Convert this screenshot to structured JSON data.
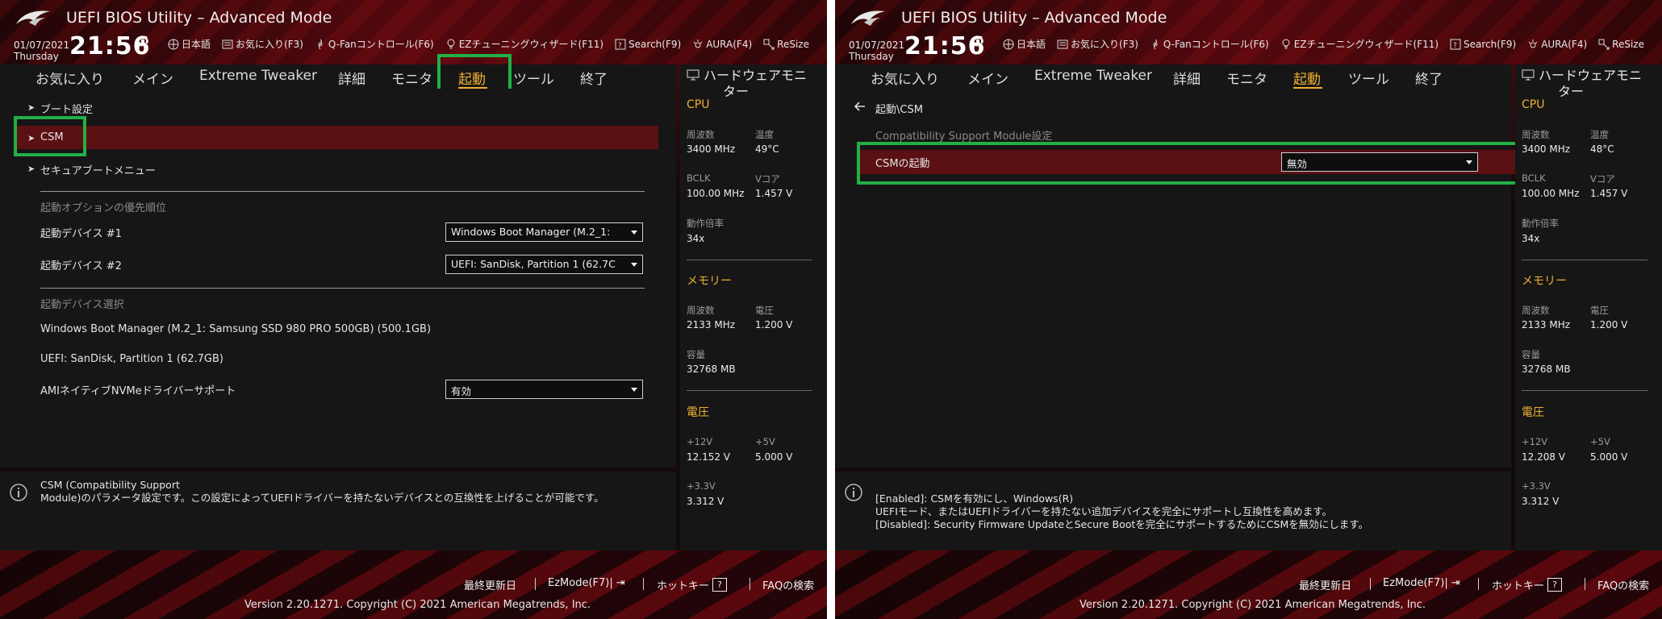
{
  "left": {
    "header": {
      "title": "UEFI BIOS Utility – Advanced Mode",
      "date": "01/07/2021",
      "weekday": "Thursday",
      "time": "21:56",
      "toolbar": [
        "日本語",
        "お気に入り(F3)",
        "Q-Fanコントロール(F6)",
        "EZチューニングウィザード(F11)",
        "Search(F9)",
        "AURA(F4)",
        "ReSize"
      ]
    },
    "tabs": [
      "お気に入り",
      "メイン",
      "Extreme Tweaker",
      "詳細",
      "モニタ",
      "起動",
      "ツール",
      "終了"
    ],
    "active_tab": "起動",
    "menu": {
      "boot_config": "ブート設定",
      "csm": "CSM",
      "secure_boot": "セキュアブートメニュー",
      "priority_header": "起動オプションの優先順位",
      "dev1_label": "起動デバイス #1",
      "dev1_value": "Windows Boot Manager (M.2_1:",
      "dev2_label": "起動デバイス #2",
      "dev2_value": "UEFI: SanDisk, Partition 1 (62.7C",
      "select_header": "起動デバイス選択",
      "device_a": "Windows Boot Manager (M.2_1: Samsung SSD 980 PRO 500GB) (500.1GB)",
      "device_b": "UEFI: SanDisk, Partition 1 (62.7GB)",
      "nvme_label": "AMIネイティブNVMeドライバーサポート",
      "nvme_value": "有効"
    },
    "help": {
      "line1": "CSM (Compatibility Support",
      "line2": "Module)のパラメータ設定です。この設定によってUEFIドライバーを持たないデバイスとの互換性を上げることが可能です。"
    },
    "hw": {
      "title_line1": "ハードウェアモニ",
      "title_line2": "ター",
      "cpu": "CPU",
      "freq_label": "周波数",
      "freq_value": "3400 MHz",
      "temp_label": "温度",
      "temp_value": "49°C",
      "bclk_label": "BCLK",
      "bclk_value": "100.00 MHz",
      "vcore_label": "Vコア",
      "vcore_value": "1.457 V",
      "ratio_label": "動作倍率",
      "ratio_value": "34x",
      "memory": "メモリー",
      "mfreq_label": "周波数",
      "mfreq_value": "2133 MHz",
      "volt_label": "電圧",
      "volt_value": "1.200 V",
      "cap_label": "容量",
      "cap_value": "32768 MB",
      "voltage": "電圧",
      "v12_label": "+12V",
      "v12_value": "12.152 V",
      "v5_label": "+5V",
      "v5_value": "5.000 V",
      "v33_label": "+3.3V",
      "v33_value": "3.312 V"
    },
    "footer": {
      "last_modified": "最終更新日",
      "ezmode": "EzMode(F7)|",
      "hotkeys": "ホットキー",
      "hotkey_glyph": "?",
      "faq": "FAQの検索",
      "copyright": "Version 2.20.1271. Copyright (C) 2021 American Megatrends, Inc."
    }
  },
  "right": {
    "header": {
      "title": "UEFI BIOS Utility – Advanced Mode",
      "date": "01/07/2021",
      "weekday": "Thursday",
      "time": "21:56",
      "toolbar": [
        "日本語",
        "お気に入り(F3)",
        "Q-Fanコントロール(F6)",
        "EZチューニングウィザード(F11)",
        "Search(F9)",
        "AURA(F4)",
        "ReSize"
      ]
    },
    "tabs": [
      "お気に入り",
      "メイン",
      "Extreme Tweaker",
      "詳細",
      "モニタ",
      "起動",
      "ツール",
      "終了"
    ],
    "active_tab": "起動",
    "menu": {
      "breadcrumb": "起動\\CSM",
      "section_header": "Compatibility Support Module設定",
      "csm_launch_label": "CSMの起動",
      "csm_launch_value": "無効"
    },
    "help": {
      "line1": "[Enabled]: CSMを有効にし、Windows(R)",
      "line2": "UEFIモード、またはUEFIドライバーを持たない追加デバイスを完全にサポートし互換性を高めます。",
      "line3": "[Disabled]: Security Firmware UpdateとSecure Bootを完全にサポートするためにCSMを無効にします。"
    },
    "hw": {
      "title_line1": "ハードウェアモニ",
      "title_line2": "ター",
      "cpu": "CPU",
      "freq_label": "周波数",
      "freq_value": "3400 MHz",
      "temp_label": "温度",
      "temp_value": "48°C",
      "bclk_label": "BCLK",
      "bclk_value": "100.00 MHz",
      "vcore_label": "Vコア",
      "vcore_value": "1.457 V",
      "ratio_label": "動作倍率",
      "ratio_value": "34x",
      "memory": "メモリー",
      "mfreq_label": "周波数",
      "mfreq_value": "2133 MHz",
      "volt_label": "電圧",
      "volt_value": "1.200 V",
      "cap_label": "容量",
      "cap_value": "32768 MB",
      "voltage": "電圧",
      "v12_label": "+12V",
      "v12_value": "12.208 V",
      "v5_label": "+5V",
      "v5_value": "5.000 V",
      "v33_label": "+3.3V",
      "v33_value": "3.312 V"
    },
    "footer": {
      "last_modified": "最終更新日",
      "ezmode": "EzMode(F7)|",
      "hotkeys": "ホットキー",
      "hotkey_glyph": "?",
      "faq": "FAQの検索",
      "copyright": "Version 2.20.1271. Copyright (C) 2021 American Megatrends, Inc."
    }
  },
  "colors": {
    "accent": "#f0b030",
    "highlight_row": "#5b1013",
    "annotation_box": "#22b045"
  }
}
